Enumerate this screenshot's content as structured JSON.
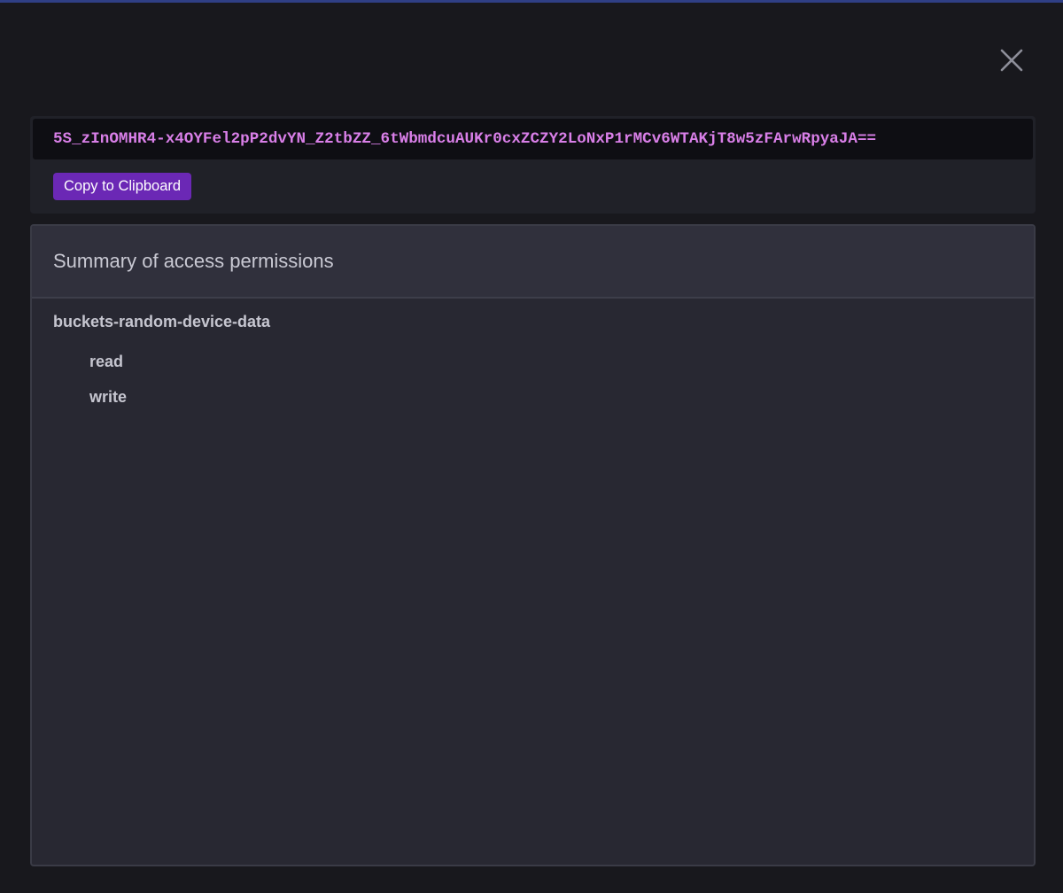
{
  "modal": {
    "close_icon": "close-icon",
    "token": "5S_zInOMHR4-x4OYFel2pP2dvYN_Z2tbZZ_6tWbmdcuAUKr0cxZCZY2LoNxP1rMCv6WTAKjT8w5zFArwRpyaJA==",
    "copy_label": "Copy to Clipboard"
  },
  "summary": {
    "title": "Summary of access permissions",
    "buckets": [
      {
        "name": "buckets-random-device-data",
        "permissions": [
          "read",
          "write"
        ]
      }
    ]
  },
  "colors": {
    "background": "#18181d",
    "accent_bar": "#2f3f85",
    "token_text": "#d97fe8",
    "button": "#6b28b5"
  }
}
